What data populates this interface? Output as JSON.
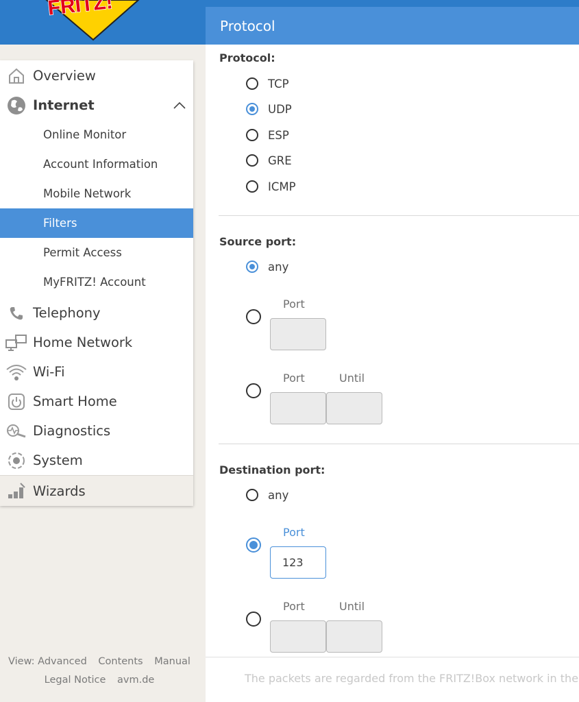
{
  "header": {
    "section_title": "Protocol"
  },
  "brand": {
    "logo_text": "FRITZ!",
    "colors": {
      "top_bar": "#2d7cc9",
      "accent": "#4a90d9",
      "logo_red": "#e2001a",
      "logo_yellow": "#ffd100"
    }
  },
  "sidebar": {
    "items": [
      {
        "label": "Overview",
        "icon": "home-icon"
      },
      {
        "label": "Internet",
        "icon": "globe-icon",
        "expanded": true
      },
      {
        "label": "Telephony",
        "icon": "phone-icon"
      },
      {
        "label": "Home Network",
        "icon": "network-icon"
      },
      {
        "label": "Wi-Fi",
        "icon": "wifi-icon"
      },
      {
        "label": "Smart Home",
        "icon": "power-icon"
      },
      {
        "label": "Diagnostics",
        "icon": "diagnostics-icon"
      },
      {
        "label": "System",
        "icon": "system-icon"
      },
      {
        "label": "Wizards",
        "icon": "wizards-icon"
      }
    ],
    "internet_sub": [
      {
        "label": "Online Monitor"
      },
      {
        "label": "Account Information"
      },
      {
        "label": "Mobile Network"
      },
      {
        "label": "Filters",
        "active": true
      },
      {
        "label": "Permit Access"
      },
      {
        "label": "MyFRITZ! Account"
      }
    ]
  },
  "footer": {
    "view": "View: Advanced",
    "contents": "Contents",
    "manual": "Manual",
    "legal": "Legal Notice",
    "site": "avm.de"
  },
  "protocol": {
    "title": "Protocol:",
    "options": [
      "TCP",
      "UDP",
      "ESP",
      "GRE",
      "ICMP"
    ],
    "selected": "UDP"
  },
  "source_port": {
    "title": "Source port:",
    "any_label": "any",
    "port_label": "Port",
    "until_label": "Until",
    "selected": "any",
    "port_value": "",
    "range_from": "",
    "range_until": ""
  },
  "destination_port": {
    "title": "Destination port:",
    "any_label": "any",
    "port_label": "Port",
    "until_label": "Until",
    "selected": "port",
    "port_value": "123",
    "range_from": "",
    "range_until": ""
  },
  "hint": "The packets are regarded from the FRITZ!Box network in the di"
}
